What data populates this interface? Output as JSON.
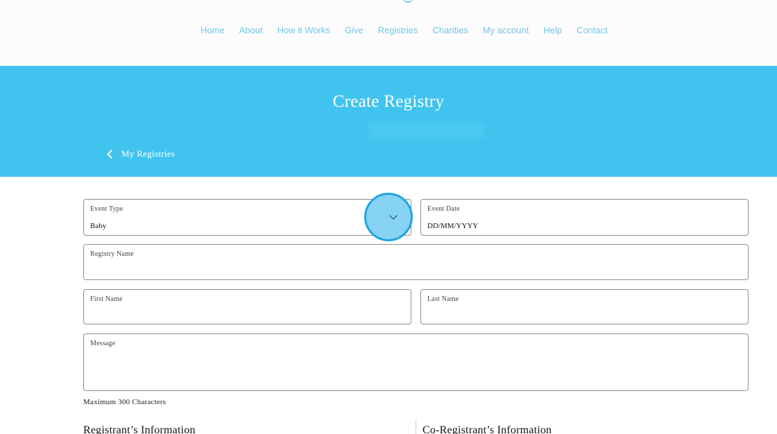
{
  "nav": {
    "items": [
      "Home",
      "About",
      "How it Works",
      "Give",
      "Registries",
      "Charities",
      "My account",
      "Help",
      "Contact"
    ]
  },
  "hero": {
    "title": "Create Registry",
    "back_label": "My Registries"
  },
  "form": {
    "event_type": {
      "label": "Event Type",
      "value": "Baby"
    },
    "event_date": {
      "label": "Event Date",
      "value": "DD/MM/YYYY"
    },
    "registry_name": {
      "label": "Registry Name",
      "value": ""
    },
    "first_name": {
      "label": "First Name",
      "value": ""
    },
    "last_name": {
      "label": "Last Name",
      "value": ""
    },
    "message": {
      "label": "Message",
      "value": ""
    },
    "message_hint": "Maximum 300 Characters"
  },
  "sections": {
    "registrant": "Registrant’s Information",
    "co_registrant": "Co-Registrant’s Information"
  },
  "colors": {
    "brand": "#40c4ef",
    "nav_link": "#6fc6e6",
    "highlight_fill": "#86d3f3",
    "highlight_border": "#1ea4de"
  },
  "icons": {
    "back": "chevron-left-icon",
    "dropdown": "chevron-down-icon"
  }
}
